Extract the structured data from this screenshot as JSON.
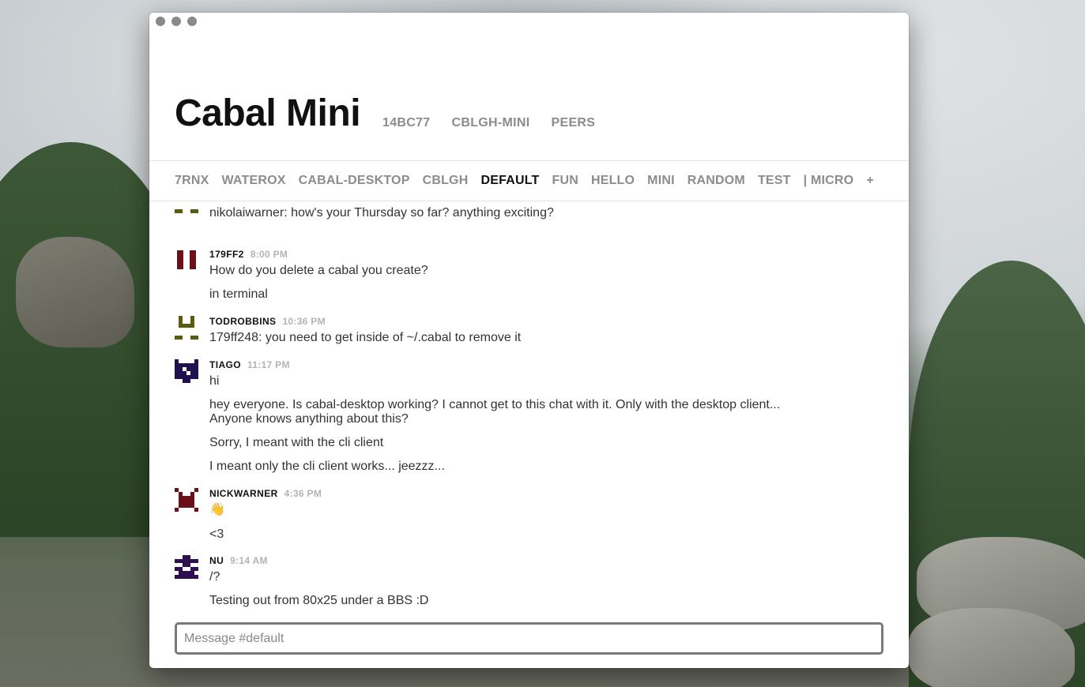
{
  "window": {
    "title": "Cabal Mini",
    "meta": [
      "14BC77",
      "CBLGH-MINI",
      "PEERS"
    ]
  },
  "channels": {
    "items": [
      "7RNX",
      "WATEROX",
      "CABAL-DESKTOP",
      "CBLGH",
      "DEFAULT",
      "FUN",
      "HELLO",
      "MINI",
      "RANDOM",
      "TEST",
      "| MICRO"
    ],
    "active": "DEFAULT",
    "add_label": "+"
  },
  "messages": [
    {
      "author": "",
      "time": "",
      "avatar": "avatar-olive",
      "lines": [
        "nikolaiwarner: how's your Thursday so far? anything exciting?"
      ]
    },
    {
      "author": "179FF2",
      "time": "8:00 PM",
      "avatar": "avatar-maroon",
      "lines": [
        "How do you delete a cabal you create?",
        "in terminal"
      ]
    },
    {
      "author": "TODROBBINS",
      "time": "10:36 PM",
      "avatar": "avatar-olive",
      "lines": [
        "179ff248: you need to get inside of ~/.cabal to remove it"
      ]
    },
    {
      "author": "TIAGO",
      "time": "11:17 PM",
      "avatar": "avatar-navy",
      "lines": [
        "hi",
        "hey everyone. Is cabal-desktop working? I cannot get to this chat with it. Only with the desktop client...",
        "Anyone knows anything about this?",
        "Sorry, I meant with the cli client",
        "I meant only the cli client works... jeezzz..."
      ]
    },
    {
      "author": "NICKWARNER",
      "time": "4:36 PM",
      "avatar": "avatar-maroon-face",
      "lines": [
        "👋",
        "<3"
      ]
    },
    {
      "author": "NU",
      "time": "9:14 AM",
      "avatar": "avatar-purple",
      "lines": [
        "/?",
        "Testing out from 80x25 under a BBS :D"
      ]
    }
  ],
  "composer": {
    "placeholder": "Message #default"
  },
  "colors": {
    "active_channel": "#111111",
    "inactive_channel": "#8c8c8c",
    "timestamp": "#b3b3b3",
    "avatar_olive": "#5c5a10",
    "avatar_maroon": "#6b0f1a",
    "avatar_navy": "#1f1150",
    "avatar_purple": "#2e0f50"
  }
}
